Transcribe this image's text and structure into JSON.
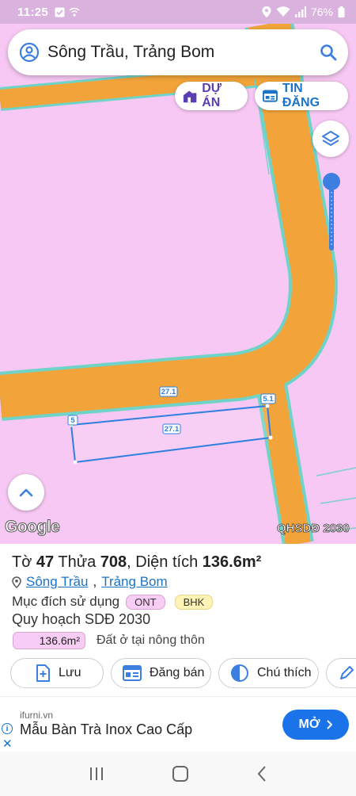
{
  "status": {
    "time": "11:25",
    "battery": "76%",
    "icons": [
      "check-box-icon",
      "wifi-calling-icon",
      "location-icon",
      "wifi-icon",
      "signal-icon",
      "battery-icon"
    ]
  },
  "search": {
    "query": "Sông Trầu, Trảng Bom"
  },
  "chips": {
    "du_an": "DỰ ÁN",
    "tin_dang": "TIN ĐĂNG"
  },
  "map": {
    "lot_labels": {
      "top": "27.1",
      "bottom": "27.1",
      "right": "5.1",
      "left": "5"
    },
    "google_label": "Google",
    "layer_badge": "QHSDĐ 2030",
    "colors": {
      "land": "#f6c8f3",
      "road": "#f2a43a",
      "border": "#6fd3c8",
      "lot": "#2f7fe0"
    }
  },
  "info": {
    "to_label": "Tờ",
    "to_value": "47",
    "thua_label": "Thửa",
    "thua_value": "708",
    "dien_tich_label": ", Diện tích",
    "dien_tich_value": "136.6m²",
    "loc_commune": "Sông Trầu",
    "loc_sep": ",",
    "loc_district": "Trảng Bom",
    "purpose_label": "Mục đích sử dụng",
    "purpose_tags": [
      "ONT",
      "BHK"
    ],
    "plan_label": "Quy hoạch SDĐ 2030",
    "area_chip": "136.6m²",
    "area_desc": "Đất ở tại nông thôn"
  },
  "actions": {
    "save": "Lưu",
    "sell": "Đăng bán",
    "legend": "Chú thích"
  },
  "ad": {
    "source": "ifurni.vn",
    "headline": "Mẫu Bàn Trà Inox Cao Cấp",
    "cta": "MỞ"
  }
}
